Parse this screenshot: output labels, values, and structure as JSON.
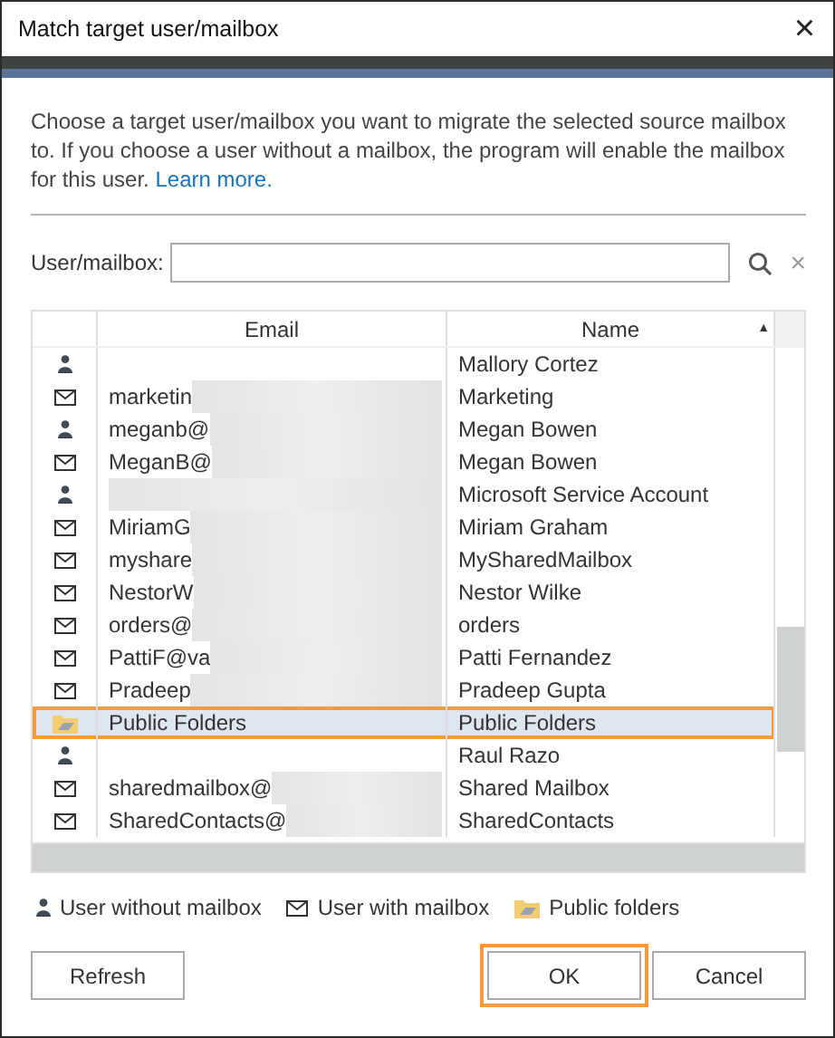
{
  "window": {
    "title": "Match target user/mailbox",
    "close": "×"
  },
  "description": {
    "text": "Choose a target user/mailbox you want to migrate the selected source mailbox to. If you choose a user without a mailbox, the program will enable the mailbox for this user.",
    "link": "Learn more."
  },
  "search": {
    "label": "User/mailbox:",
    "clear": "×"
  },
  "table": {
    "columns": [
      "Email",
      "Name"
    ],
    "sort_mark": "▲",
    "rows": [
      {
        "kind": "user",
        "email": "",
        "name": "Mallory Cortez",
        "redacted": false,
        "selected": false
      },
      {
        "kind": "mailbox",
        "email": "marketin",
        "name": "Marketing",
        "redacted": true,
        "selected": false
      },
      {
        "kind": "user",
        "email": "meganb@",
        "name": "Megan Bowen",
        "redacted": true,
        "selected": false
      },
      {
        "kind": "mailbox",
        "email": "MeganB@",
        "name": "Megan Bowen",
        "redacted": true,
        "selected": false
      },
      {
        "kind": "user",
        "email": "",
        "name": "Microsoft Service Account",
        "redacted": true,
        "selected": false
      },
      {
        "kind": "mailbox",
        "email": "MiriamG",
        "name": "Miriam Graham",
        "redacted": true,
        "selected": false
      },
      {
        "kind": "mailbox",
        "email": "myshare",
        "name": "MySharedMailbox",
        "redacted": true,
        "selected": false
      },
      {
        "kind": "mailbox",
        "email": "NestorW",
        "name": "Nestor Wilke",
        "redacted": true,
        "selected": false
      },
      {
        "kind": "mailbox",
        "email": "orders@",
        "name": "orders",
        "redacted": true,
        "selected": false
      },
      {
        "kind": "mailbox",
        "email": "PattiF@va",
        "name": "Patti Fernandez",
        "redacted": true,
        "selected": false
      },
      {
        "kind": "mailbox",
        "email": "Pradeep",
        "name": "Pradeep Gupta",
        "redacted": true,
        "selected": false
      },
      {
        "kind": "folder",
        "email": "Public Folders",
        "name": "Public Folders",
        "redacted": false,
        "selected": true
      },
      {
        "kind": "user",
        "email": "",
        "name": "Raul Razo",
        "redacted": false,
        "selected": false
      },
      {
        "kind": "mailbox",
        "email": "sharedmailbox@",
        "name": "Shared Mailbox",
        "redacted": true,
        "selected": false
      },
      {
        "kind": "mailbox",
        "email": "SharedContacts@",
        "name": "SharedContacts",
        "redacted": true,
        "selected": false
      }
    ]
  },
  "legend": [
    {
      "kind": "user",
      "label": "User without mailbox"
    },
    {
      "kind": "mailbox",
      "label": "User with mailbox"
    },
    {
      "kind": "folder",
      "label": "Public folders"
    }
  ],
  "buttons": [
    {
      "label": "Refresh",
      "highlighted": false
    },
    {
      "label": "OK",
      "highlighted": true
    },
    {
      "label": "Cancel",
      "highlighted": false
    }
  ]
}
